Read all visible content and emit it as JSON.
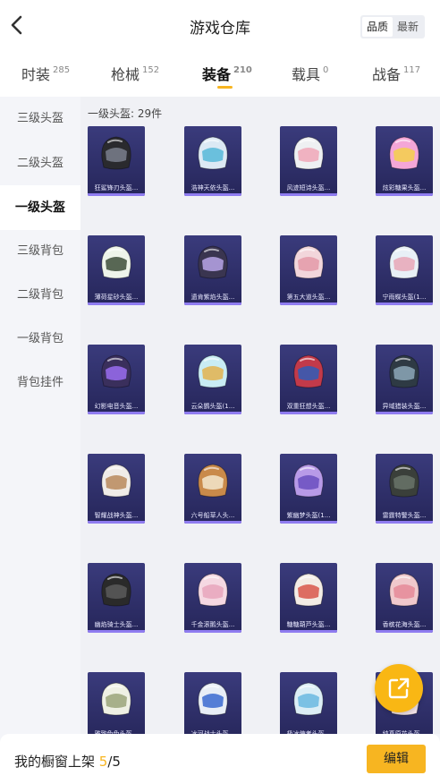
{
  "header": {
    "title": "游戏仓库",
    "sort": [
      "品质",
      "最新"
    ]
  },
  "tabs": [
    {
      "label": "时装",
      "count": "285"
    },
    {
      "label": "枪械",
      "count": "152"
    },
    {
      "label": "装备",
      "count": "210"
    },
    {
      "label": "载具",
      "count": "0"
    },
    {
      "label": "战备",
      "count": "117"
    }
  ],
  "sidebar": {
    "items": [
      "三级头盔",
      "二级头盔",
      "一级头盔",
      "三级背包",
      "二级背包",
      "一级背包",
      "背包挂件"
    ]
  },
  "content": {
    "count_label": "一级头盔: 29件",
    "items": [
      {
        "name": "狂鲨锋刃头盔...",
        "color": "#2a2a2e",
        "accent": "#7a7f8c"
      },
      {
        "name": "浩神天依头盔...",
        "color": "#dce9f4",
        "accent": "#56b9d8"
      },
      {
        "name": "风迹短诗头盔...",
        "color": "#eef0f2",
        "accent": "#f0a7b8"
      },
      {
        "name": "炫彩糖果头盔...",
        "color": "#f4a6d7",
        "accent": "#f3d04a"
      },
      {
        "name": "薄荷星砂头盔...",
        "color": "#eef4ea",
        "accent": "#3d4e3a"
      },
      {
        "name": "遗肯紫焰头盔...",
        "color": "#3a3550",
        "accent": "#b8a4e8"
      },
      {
        "name": "第五大道头盔...",
        "color": "#f2d6db",
        "accent": "#e49aa8"
      },
      {
        "name": "宁雨蝶头盔(1...",
        "color": "#e8f0f6",
        "accent": "#e8a7b7"
      },
      {
        "name": "幻影电音头盔...",
        "color": "#3a2f5c",
        "accent": "#9a6cf0"
      },
      {
        "name": "云朵鹦头盔(1...",
        "color": "#c9ecf4",
        "accent": "#e3b34d"
      },
      {
        "name": "双重狂想头盔...",
        "color": "#c23a4a",
        "accent": "#2f5db8"
      },
      {
        "name": "异域猎装头盔...",
        "color": "#2e3a44",
        "accent": "#8ca8b8"
      },
      {
        "name": "智耀战神头盔...",
        "color": "#f0ece8",
        "accent": "#b88a5c"
      },
      {
        "name": "六号船草人头...",
        "color": "#c98a4a",
        "accent": "#f3e6cc"
      },
      {
        "name": "紫幽梦头盔(1...",
        "color": "#b89ae8",
        "accent": "#6a4fc0"
      },
      {
        "name": "雷霆特警头盔...",
        "color": "#3a3f3a",
        "accent": "#6a746a"
      },
      {
        "name": "幽焰骑士头盔...",
        "color": "#2a2a2a",
        "accent": "#5a5a5a"
      },
      {
        "name": "千金滚鹅头盔...",
        "color": "#f5d8e2",
        "accent": "#e8a6bc"
      },
      {
        "name": "糖糖葫芦头盔...",
        "color": "#f3ece6",
        "accent": "#d8574a"
      },
      {
        "name": "香槟花海头盔...",
        "color": "#f0c8cc",
        "accent": "#e58a98"
      },
      {
        "name": "雅致兔兔头盔...",
        "color": "#eef0e4",
        "accent": "#9aa47a"
      },
      {
        "name": "冰河战士头盔...",
        "color": "#e8eef6",
        "accent": "#3a6ad0"
      },
      {
        "name": "极冰使者头盔...",
        "color": "#dceef6",
        "accent": "#6ab8e0"
      },
      {
        "name": "纯真原花头盔...",
        "color": "#f4e4ea",
        "accent": "#e8a0b0"
      }
    ]
  },
  "footer": {
    "label": "我的橱窗上架",
    "current": "5",
    "total": "/5",
    "edit_label": "编辑"
  }
}
